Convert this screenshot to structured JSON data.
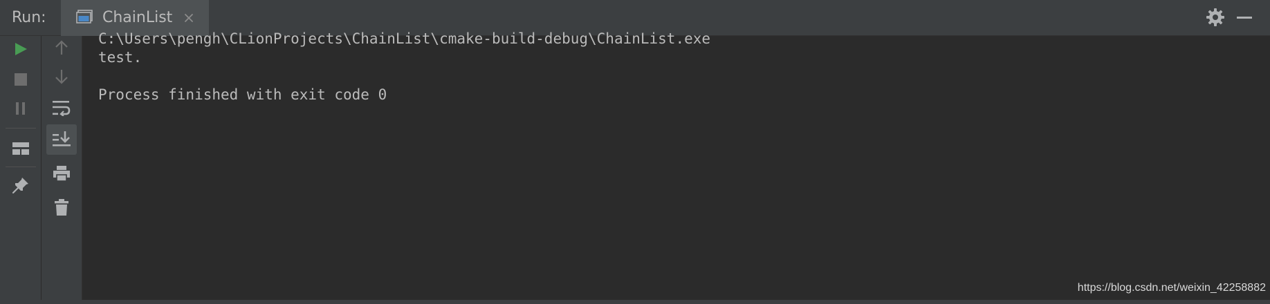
{
  "header": {
    "run_label": "Run:",
    "tab_label": "ChainList"
  },
  "toolbar": {
    "primary": [
      {
        "name": "rerun-icon",
        "color": "#499c54"
      },
      {
        "name": "stop-icon"
      },
      {
        "name": "pause-icon"
      },
      {
        "name": "layout-icon"
      },
      {
        "name": "pin-icon"
      }
    ],
    "secondary": [
      {
        "name": "up-arrow-icon"
      },
      {
        "name": "down-arrow-icon"
      },
      {
        "name": "soft-wrap-icon"
      },
      {
        "name": "scroll-to-end-icon",
        "active": true
      },
      {
        "name": "print-icon"
      },
      {
        "name": "trash-icon"
      }
    ]
  },
  "console": {
    "lines": [
      "C:\\Users\\pengh\\CLionProjects\\ChainList\\cmake-build-debug\\ChainList.exe",
      "test.",
      "",
      "Process finished with exit code 0"
    ]
  },
  "watermark": "https://blog.csdn.net/weixin_42258882",
  "colors": {
    "background": "#2b2b2b",
    "panel": "#3c3f41",
    "text": "#bbbbbb",
    "run_green": "#499c54"
  }
}
